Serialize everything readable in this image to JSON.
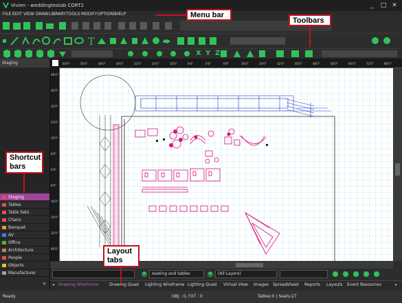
{
  "window": {
    "title": "Vivien - weddingtestab CORT2",
    "minimize": "_",
    "maximize": "□",
    "close": "✕"
  },
  "menu": [
    "FILE",
    "EDIT",
    "VIEW",
    "DRAW",
    "LIBRARY",
    "TOOLS",
    "MODIFY",
    "OPTIONS",
    "HELP"
  ],
  "toolbar_axes": [
    "X",
    "Y",
    "Z"
  ],
  "rulers": {
    "top": [
      "64'0\"",
      "56'0\"",
      "48'0\"",
      "40'0\"",
      "32'0\"",
      "24'0\"",
      "16'0\"",
      "8'0\"",
      "0'0\"",
      "8'0\"",
      "16'0\"",
      "24'0\"",
      "32'0\"",
      "40'0\"",
      "48'0\"",
      "56'0\"",
      "64'0\"",
      "72'0\"",
      "80'0\""
    ],
    "left": [
      "48'0\"",
      "40'0\"",
      "32'0\"",
      "24'0\"",
      "16'0\"",
      "8'0\"",
      "0'0\"",
      "8'0\"",
      "16'0\"",
      "24'0\"",
      "32'0\"",
      "40'0\""
    ]
  },
  "shortcut_panel": {
    "header": "Staging",
    "items": [
      {
        "label": "Staging",
        "active": true,
        "color": "#e05050"
      },
      {
        "label": "Tables",
        "active": false,
        "color": "#e05050"
      },
      {
        "label": "Table Sets",
        "active": false,
        "color": "#e05050"
      },
      {
        "label": "Chairs",
        "active": false,
        "color": "#e05050"
      },
      {
        "label": "Banquet",
        "active": false,
        "color": "#e0a030"
      },
      {
        "label": "AV",
        "active": false,
        "color": "#4080e0"
      },
      {
        "label": "Office",
        "active": false,
        "color": "#60b030"
      },
      {
        "label": "Architecture",
        "active": false,
        "color": "#c08040"
      },
      {
        "label": "People",
        "active": false,
        "color": "#e05050"
      },
      {
        "label": "Objects",
        "active": false,
        "color": "#e0c030"
      },
      {
        "label": "Manufacturer",
        "active": false,
        "color": "#a0a0a0"
      }
    ]
  },
  "layer_bar": {
    "object_dropdown": "seating and tables",
    "layer_dropdown": "(All Layers)"
  },
  "layout_tabs": [
    "Drawing Wireframe",
    "Drawing Quad",
    "Lighting Wireframe",
    "Lighting Quad",
    "Virtual View",
    "Images",
    "Spreadsheet",
    "Reports",
    "Layouts",
    "Event Resources"
  ],
  "status": {
    "state": "Ready",
    "objects": "OBJ : 0, FXT : 0",
    "tables": "Tables:0 | Seats:27"
  },
  "callouts": {
    "menu_bar": "Menu bar",
    "toolbars": "Toolbars",
    "shortcut_bars": "Shortcut bars",
    "layout_tabs": "Layout tabs"
  },
  "colors": {
    "accent": "#a0449a",
    "callout_border": "#c4121a",
    "toolbar_green": "#2ec45a",
    "drawing_grid": "#9fe0e6",
    "drawing_magenta": "#e0107e",
    "drawing_blue": "#2a3cc8"
  }
}
